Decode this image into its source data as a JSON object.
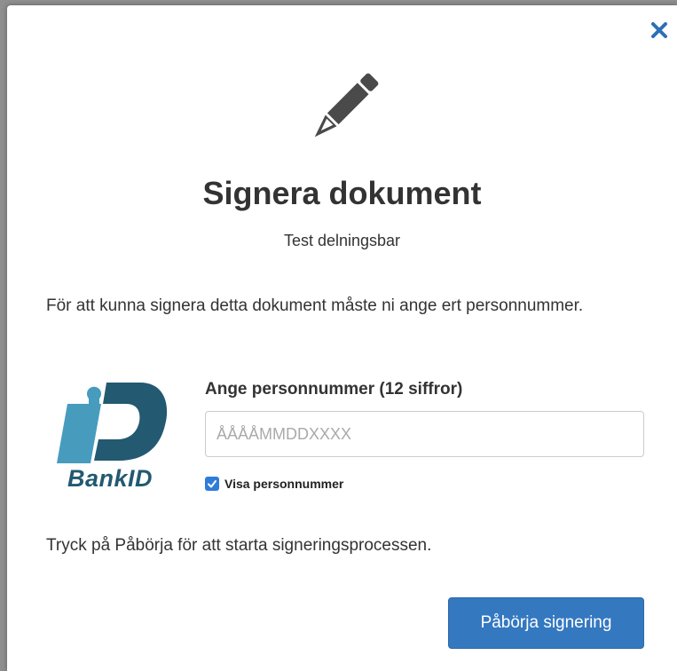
{
  "dialog": {
    "title": "Signera dokument",
    "document_name": "Test delningsbar",
    "instruction": "För att kunna signera detta dokument måste ni ange ert personnummer.",
    "close_icon": "close-icon",
    "header_icon": "pencil-icon"
  },
  "bankid": {
    "logo_text": "BankID",
    "colors": {
      "dark": "#235971",
      "light": "#479cbe"
    }
  },
  "form": {
    "field_label": "Ange personnummer (12 siffror)",
    "personnummer_value": "",
    "personnummer_placeholder": "ÅÅÅÅMMDDXXXX",
    "show_checkbox_label": "Visa personnummer",
    "show_checkbox_checked": true
  },
  "footer": {
    "hint": "Tryck på Påbörja för att starta signeringsprocessen.",
    "start_button_label": "Påbörja signering"
  },
  "colors": {
    "primary_button": "#3478c0",
    "close_icon": "#2f6fb5",
    "checkbox": "#2f7cd9",
    "text": "#333333"
  }
}
